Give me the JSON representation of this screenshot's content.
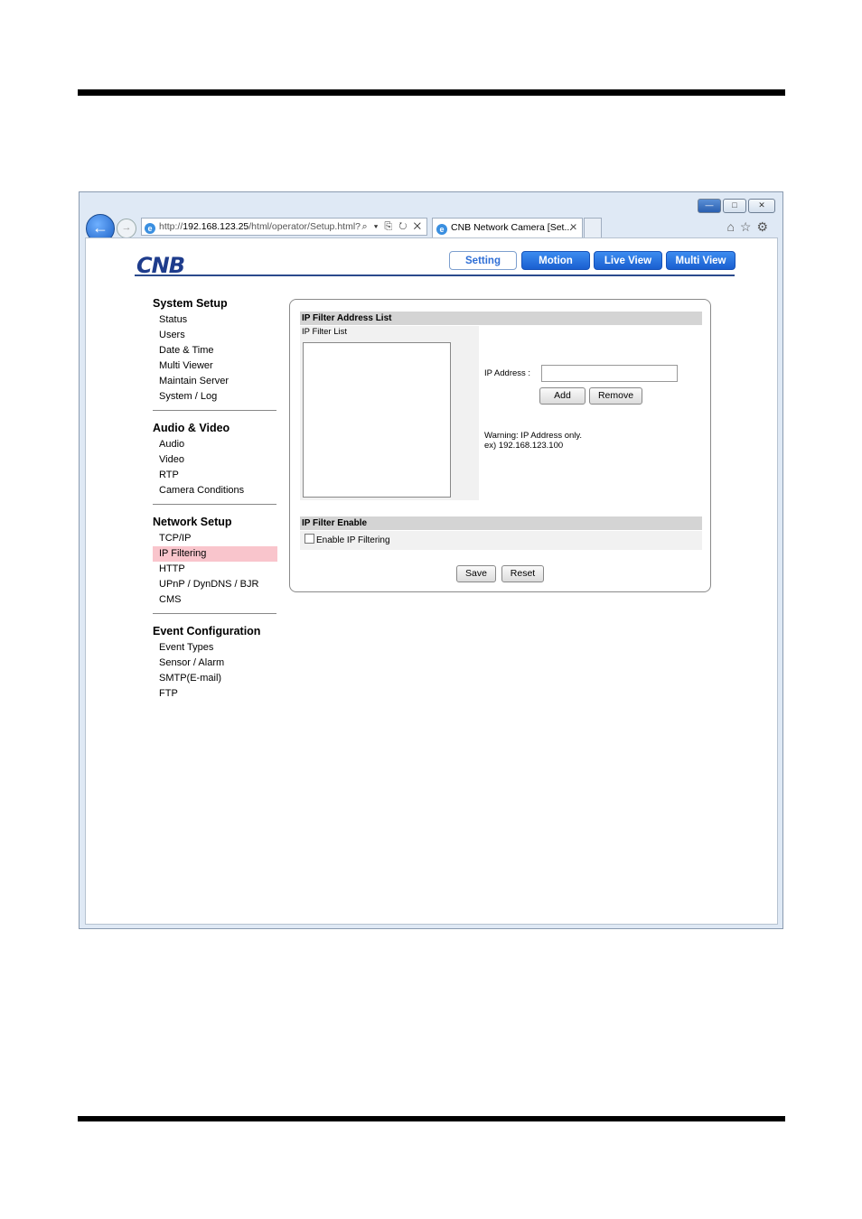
{
  "browser": {
    "window_controls": {
      "minimize": "—",
      "restore": "□",
      "close": "✕"
    },
    "back_icon": "←",
    "forward_icon": "→",
    "url_prefix": "http://",
    "url_host": "192.168.123.25",
    "url_path": "/html/operator/Setup.html?",
    "address_tools": "⌕ ▾ ⎘ ↻ ✕",
    "tab_title": "CNB Network Camera [Set...",
    "tab_close": "✕",
    "toolbar_icons": "⌂☆⚙",
    "ie_glyph": "e"
  },
  "header": {
    "logo": "CNB",
    "nav": [
      {
        "label": "Setting",
        "active": true
      },
      {
        "label": "Motion",
        "active": false
      },
      {
        "label": "Live View",
        "active": false
      },
      {
        "label": "Multi View",
        "active": false
      }
    ]
  },
  "sidebar": {
    "sections": [
      {
        "title": "System Setup",
        "items": [
          "Status",
          "Users",
          "Date & Time",
          "Multi Viewer",
          "Maintain Server",
          "System / Log"
        ]
      },
      {
        "title": "Audio & Video",
        "items": [
          "Audio",
          "Video",
          "RTP",
          "Camera Conditions"
        ]
      },
      {
        "title": "Network Setup",
        "items": [
          "TCP/IP",
          "IP Filtering",
          "HTTP",
          "UPnP / DynDNS / BJR",
          "CMS"
        ]
      },
      {
        "title": "Event Configuration",
        "items": [
          "Event Types",
          "Sensor / Alarm",
          "SMTP(E-mail)",
          "FTP"
        ]
      }
    ],
    "selected": "IP Filtering"
  },
  "panel": {
    "address_list_title": "IP Filter Address List",
    "filter_list_label": "IP Filter List",
    "ip_address_label": "IP Address :",
    "ip_address_value": "",
    "add_label": "Add",
    "remove_label": "Remove",
    "warning_line1": "Warning: IP Address only.",
    "warning_line2": "ex) 192.168.123.100",
    "enable_title": "IP Filter Enable",
    "enable_label": "Enable IP Filtering",
    "enable_checked": false,
    "save_label": "Save",
    "reset_label": "Reset"
  }
}
